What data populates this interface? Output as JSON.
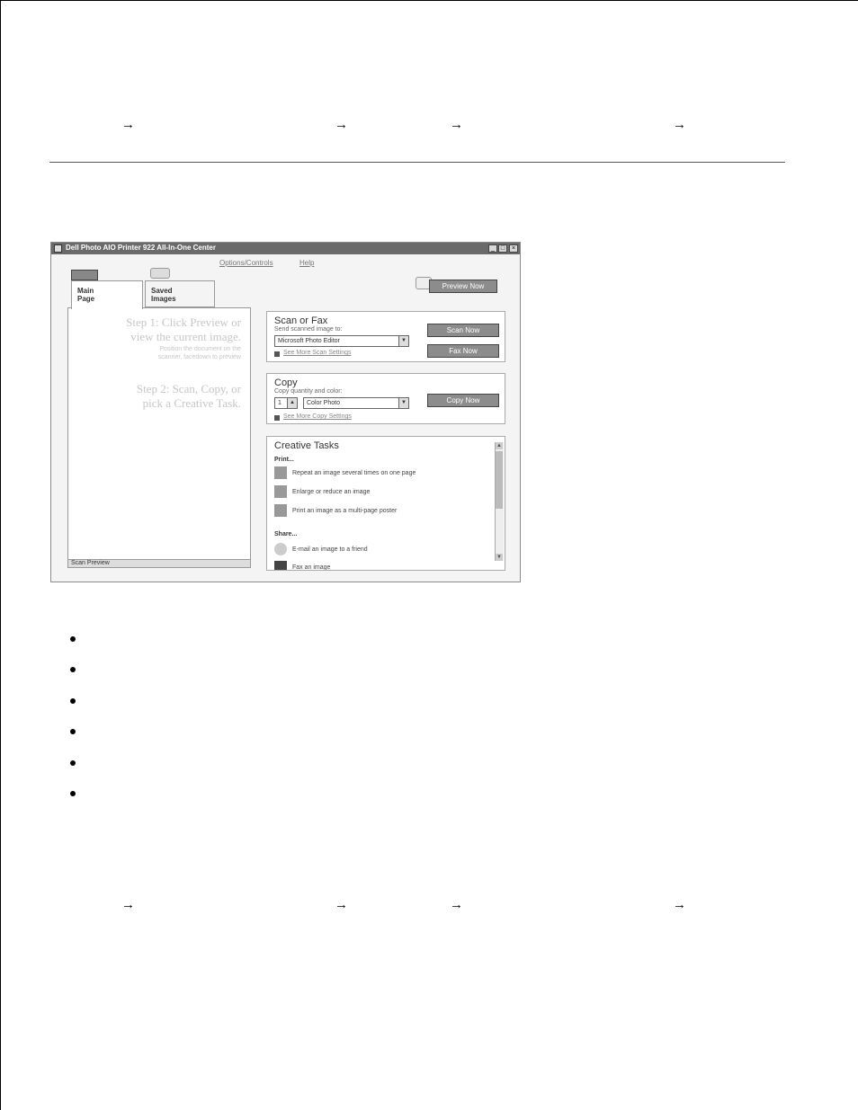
{
  "nav_top": {
    "arrow": "→"
  },
  "nav_bottom": {
    "arrow": "→"
  },
  "dialog": {
    "title": "Dell Photo AIO Printer 922 All-In-One Center",
    "menu": [
      "Options/Controls",
      "Help"
    ],
    "preview_button": "Preview Now",
    "tabs": [
      {
        "line1": "Main",
        "line2": "Page"
      },
      {
        "line1": "Saved",
        "line2": "Images"
      }
    ],
    "steps": {
      "step1_a": "Step 1:  Click Preview or",
      "step1_b": "view the current image.",
      "step1_sub_a": "Position the document on the",
      "step1_sub_b": "scanner, facedown to preview",
      "step2_a": "Step 2:  Scan, Copy, or",
      "step2_b": "pick a Creative Task."
    },
    "status": "Scan Preview",
    "scan_section": {
      "title": "Scan or Fax",
      "subtitle": "Send scanned image to:",
      "destination": "Microsoft Photo Editor",
      "scan_button": "Scan Now",
      "fax_button": "Fax Now",
      "settings_link": "See More Scan Settings"
    },
    "copy_section": {
      "title": "Copy",
      "subtitle": "Copy quantity and color:",
      "quantity": "1",
      "color": "Color Photo",
      "copy_button": "Copy Now",
      "settings_link": "See More Copy Settings"
    },
    "creative_section": {
      "title": "Creative Tasks",
      "print_label": "Print...",
      "print_tasks": [
        "Repeat an image several times on one page",
        "Enlarge or reduce an image",
        "Print an image as a multi-page poster"
      ],
      "share_label": "Share...",
      "share_tasks": [
        "E-mail an image to a friend",
        "Fax an image"
      ]
    }
  }
}
